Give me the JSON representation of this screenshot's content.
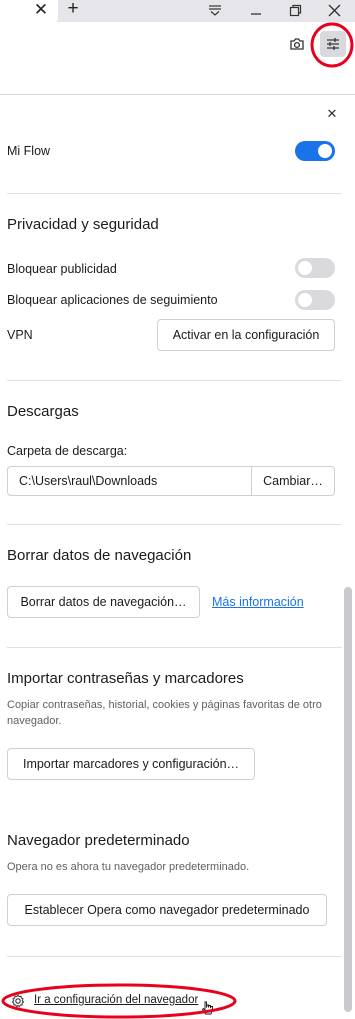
{
  "titlebar": {
    "tab_close_glyph": "✕",
    "new_tab_glyph": "+"
  },
  "panel": {
    "close_glyph": "✕",
    "my_flow": {
      "label": "Mi Flow",
      "enabled": true
    },
    "privacy": {
      "title": "Privacidad y seguridad",
      "block_ads": {
        "label": "Bloquear publicidad",
        "enabled": false
      },
      "block_trackers": {
        "label": "Bloquear aplicaciones de seguimiento",
        "enabled": false
      },
      "vpn": {
        "label": "VPN",
        "button": "Activar en la configuración"
      }
    },
    "downloads": {
      "title": "Descargas",
      "folder_label": "Carpeta de descarga:",
      "folder_path": "C:\\Users\\raul\\Downloads",
      "change_button": "Cambiar…"
    },
    "clear_data": {
      "title": "Borrar datos de navegación",
      "button": "Borrar datos de navegación…",
      "more_info_link": "Más información"
    },
    "import": {
      "title": "Importar contraseñas y marcadores",
      "description": "Copiar contraseñas, historial, cookies y páginas favoritas de otro navegador.",
      "button": "Importar marcadores y configuración…"
    },
    "default_browser": {
      "title": "Navegador predeterminado",
      "description": "Opera no es ahora tu navegador predeterminado.",
      "button": "Establecer Opera como navegador predeterminado"
    },
    "footer_link": "Ir a configuración del navegador"
  },
  "icons": {
    "tab_close": "close-icon",
    "new_tab": "plus-icon",
    "tab_menu": "tab-menu-icon",
    "minimize": "minimize-icon",
    "restore": "restore-icon",
    "window_close": "close-icon",
    "snapshot": "camera-icon",
    "easy_setup": "sliders-icon",
    "settings": "gear-icon"
  },
  "colors": {
    "accent": "#1a73e8",
    "annotation": "#e8001c",
    "toggle_off": "#dadade"
  }
}
